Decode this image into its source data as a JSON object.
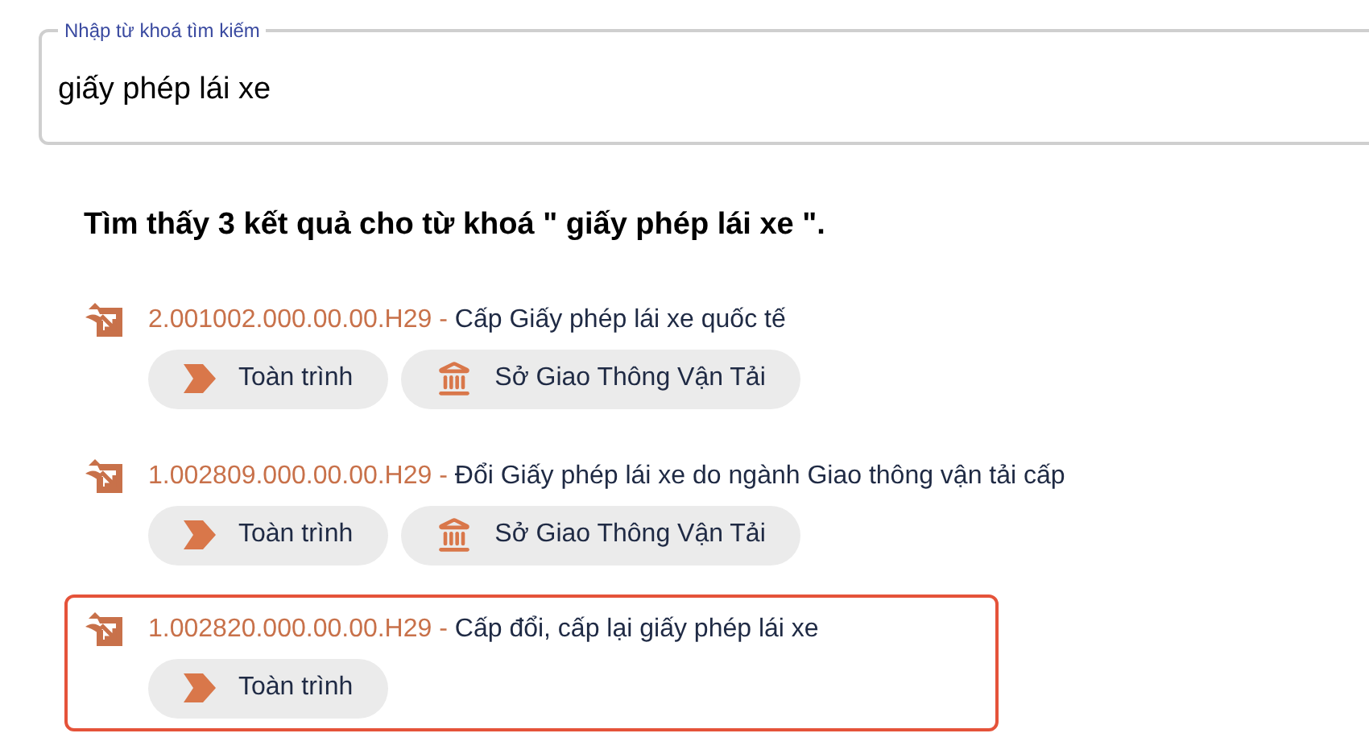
{
  "search": {
    "label": "Nhập từ khoá tìm kiếm",
    "value": "giấy phép lái xe"
  },
  "summary": "Tìm thấy 3 kết quả cho từ khoá \" giấy phép lái xe \".",
  "results": [
    {
      "code": "2.001002.000.00.00.H29",
      "separator": "-",
      "title": "Cấp Giấy phép lái xe quốc tế",
      "highlighted": false,
      "tags": [
        {
          "kind": "scope",
          "label": "Toàn trình"
        },
        {
          "kind": "agency",
          "label": "Sở Giao Thông Vận Tải"
        }
      ]
    },
    {
      "code": "1.002809.000.00.00.H29",
      "separator": "-",
      "title": "Đổi Giấy phép lái xe do ngành Giao thông vận tải cấp",
      "highlighted": false,
      "tags": [
        {
          "kind": "scope",
          "label": "Toàn trình"
        },
        {
          "kind": "agency",
          "label": "Sở Giao Thông Vận Tải"
        }
      ]
    },
    {
      "code": "1.002820.000.00.00.H29",
      "separator": "-",
      "title": "Cấp đổi, cấp lại giấy phép lái xe",
      "highlighted": true,
      "tags": [
        {
          "kind": "scope",
          "label": "Toàn trình"
        }
      ]
    }
  ]
}
